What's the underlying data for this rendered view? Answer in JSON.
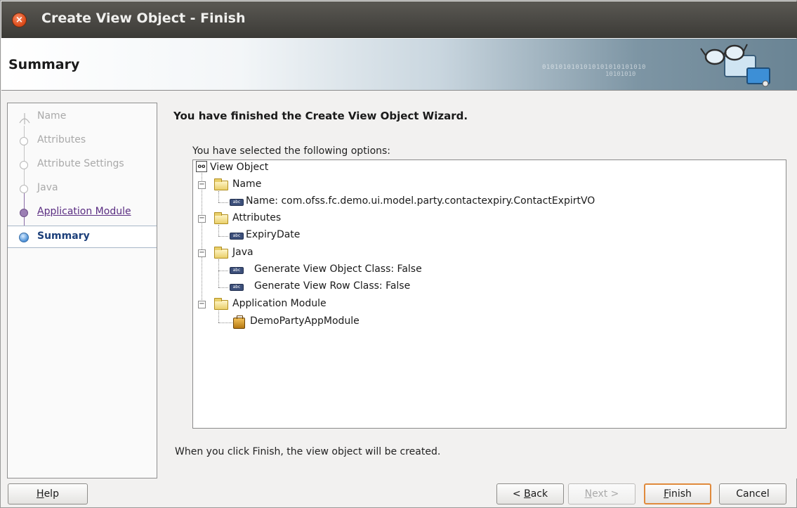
{
  "window": {
    "title": "Create View Object - Finish",
    "close_glyph": "×"
  },
  "header": {
    "title": "Summary",
    "binary_text_1": "0101010101010101010101010",
    "binary_text_2": "10101010"
  },
  "nav": {
    "items": [
      {
        "label": "Name",
        "state": "disabled"
      },
      {
        "label": "Attributes",
        "state": "disabled"
      },
      {
        "label": "Attribute Settings",
        "state": "disabled"
      },
      {
        "label": "Java",
        "state": "disabled"
      },
      {
        "label": "Application Module",
        "state": "visited"
      },
      {
        "label": "Summary",
        "state": "current"
      }
    ]
  },
  "content": {
    "heading": "You have finished the Create View Object Wizard.",
    "options_label": "You have selected the following options:",
    "footer_note": "When you click Finish, the view object will be created."
  },
  "tree": {
    "root": {
      "label": "View Object",
      "icon": "view-object-icon"
    },
    "groups": [
      {
        "label": "Name",
        "expanded": true,
        "children": [
          {
            "label": "Name: com.ofss.fc.demo.ui.model.party.contactexpiry.ContactExpirtVO",
            "icon": "attribute-icon"
          }
        ]
      },
      {
        "label": "Attributes",
        "expanded": true,
        "children": [
          {
            "label": "ExpiryDate",
            "icon": "attribute-icon"
          }
        ]
      },
      {
        "label": "Java",
        "expanded": true,
        "children": [
          {
            "label": "Generate View Object Class: False",
            "icon": "attribute-icon"
          },
          {
            "label": "Generate View Row Class: False",
            "icon": "attribute-icon"
          }
        ]
      },
      {
        "label": "Application Module",
        "expanded": true,
        "children": [
          {
            "label": "DemoPartyAppModule",
            "icon": "application-module-icon"
          }
        ]
      }
    ],
    "expander_glyph": "−",
    "attr_icon_text": "abc"
  },
  "buttons": {
    "help": {
      "mnemonic": "H",
      "rest": "elp"
    },
    "back": {
      "prefix": "< ",
      "mnemonic": "B",
      "rest": "ack"
    },
    "next": {
      "mnemonic": "N",
      "rest": "ext >"
    },
    "finish": {
      "mnemonic": "F",
      "rest": "inish"
    },
    "cancel": {
      "label": "Cancel"
    }
  },
  "colors": {
    "titlebar": "#3c3b37",
    "close": "#e0501f",
    "visited_link": "#5a2d82",
    "current_step": "#1c3f7a",
    "default_button_border": "#e08a3c"
  }
}
